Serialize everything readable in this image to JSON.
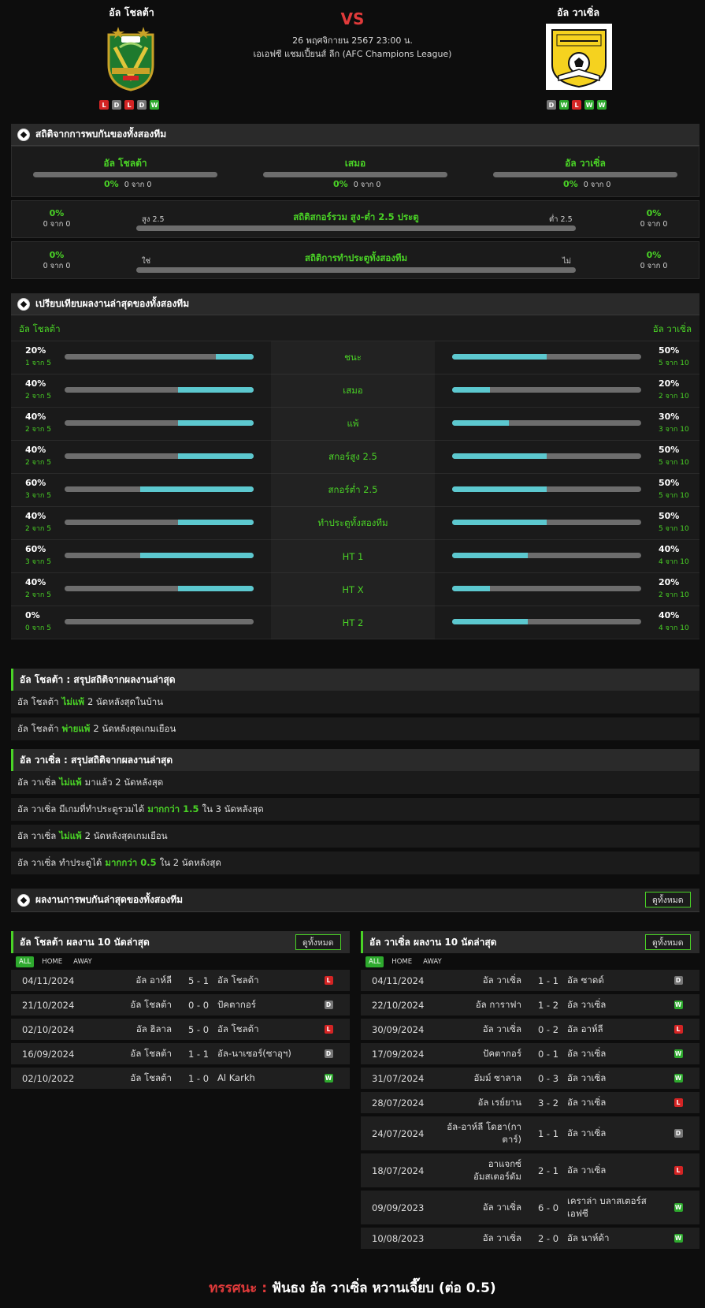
{
  "header": {
    "home_team": "อัล โชลต้า",
    "away_team": "อัล วาเซิ่ล",
    "vs": "VS",
    "datetime": "26 พฤศจิกายน 2567 23:00 น.",
    "league": "เอเอฟซี แชมเปี้ยนส์ ลีก (AFC Champions League)",
    "home_form": [
      "L",
      "D",
      "L",
      "D",
      "W"
    ],
    "away_form": [
      "D",
      "W",
      "L",
      "W",
      "W"
    ]
  },
  "h2h": {
    "title": "สถิติจากการพบกันของทั้งสองทีม",
    "cols": [
      {
        "name": "อัล โชลต้า",
        "pct": "0%",
        "count": "0 จาก 0",
        "frac": 0
      },
      {
        "name": "เสมอ",
        "pct": "0%",
        "count": "0 จาก 0",
        "frac": 0
      },
      {
        "name": "อัล วาเซิ่ล",
        "pct": "0%",
        "count": "0 จาก 0",
        "frac": 0
      }
    ],
    "ou": {
      "title": "สถิติสกอร์รวม สูง-ต่ำ 2.5 ประตู",
      "left_label": "สูง 2.5",
      "right_label": "ต่ำ 2.5",
      "left_pct": "0%",
      "left_count": "0 จาก 0",
      "right_pct": "0%",
      "right_count": "0 จาก 0"
    },
    "btts": {
      "title": "สถิติการทำประตูทั้งสองทีม",
      "left_label": "ใช่",
      "right_label": "ไม่",
      "left_pct": "0%",
      "left_count": "0 จาก 0",
      "right_pct": "0%",
      "right_count": "0 จาก 0"
    }
  },
  "compare": {
    "title": "เปรียบเทียบผลงานล่าสุดของทั้งสองทีม",
    "left_team": "อัล โชลต้า",
    "right_team": "อัล วาเซิ่ล",
    "rows": [
      {
        "label": "ชนะ",
        "l_pct": "20%",
        "l_sub": "1 จาก 5",
        "l_frac": 0.2,
        "r_pct": "50%",
        "r_sub": "5 จาก 10",
        "r_frac": 0.5
      },
      {
        "label": "เสมอ",
        "l_pct": "40%",
        "l_sub": "2 จาก 5",
        "l_frac": 0.4,
        "r_pct": "20%",
        "r_sub": "2 จาก 10",
        "r_frac": 0.2
      },
      {
        "label": "แพ้",
        "l_pct": "40%",
        "l_sub": "2 จาก 5",
        "l_frac": 0.4,
        "r_pct": "30%",
        "r_sub": "3 จาก 10",
        "r_frac": 0.3
      },
      {
        "label": "สกอร์สูง 2.5",
        "l_pct": "40%",
        "l_sub": "2 จาก 5",
        "l_frac": 0.4,
        "r_pct": "50%",
        "r_sub": "5 จาก 10",
        "r_frac": 0.5
      },
      {
        "label": "สกอร์ต่ำ 2.5",
        "l_pct": "60%",
        "l_sub": "3 จาก 5",
        "l_frac": 0.6,
        "r_pct": "50%",
        "r_sub": "5 จาก 10",
        "r_frac": 0.5
      },
      {
        "label": "ทำประตูทั้งสองทีม",
        "l_pct": "40%",
        "l_sub": "2 จาก 5",
        "l_frac": 0.4,
        "r_pct": "50%",
        "r_sub": "5 จาก 10",
        "r_frac": 0.5
      },
      {
        "label": "HT 1",
        "l_pct": "60%",
        "l_sub": "3 จาก 5",
        "l_frac": 0.6,
        "r_pct": "40%",
        "r_sub": "4 จาก 10",
        "r_frac": 0.4
      },
      {
        "label": "HT X",
        "l_pct": "40%",
        "l_sub": "2 จาก 5",
        "l_frac": 0.4,
        "r_pct": "20%",
        "r_sub": "2 จาก 10",
        "r_frac": 0.2
      },
      {
        "label": "HT 2",
        "l_pct": "0%",
        "l_sub": "0 จาก 5",
        "l_frac": 0.0,
        "r_pct": "40%",
        "r_sub": "4 จาก 10",
        "r_frac": 0.4
      }
    ]
  },
  "summary_home": {
    "title": "อัล โชลต้า : สรุปสถิติจากผลงานล่าสุด",
    "rows": [
      {
        "pre": "อัล โชลต้า",
        "hl": "ไม่แพ้",
        "post": "2  นัดหลังสุดในบ้าน"
      },
      {
        "pre": "อัล โชลต้า",
        "hl": "พ่ายแพ้",
        "post": "2  นัดหลังสุดเกมเยือน"
      }
    ]
  },
  "summary_away": {
    "title": "อัล วาเซิ่ล : สรุปสถิติจากผลงานล่าสุด",
    "rows": [
      {
        "pre": "อัล วาเซิ่ล",
        "hl": "ไม่แพ้",
        "post": "มาแล้ว 2 นัดหลังสุด",
        "hl2": "",
        "post2": ""
      },
      {
        "pre": "อัล วาเซิ่ล  มีเกมที่ทำประตูรวมได้",
        "hl": "มากกว่า  1.5",
        "post": "ใน 3 นัดหลังสุด",
        "hl2": "",
        "post2": ""
      },
      {
        "pre": "อัล วาเซิ่ล",
        "hl": "ไม่แพ้",
        "post": "2  นัดหลังสุดเกมเยือน",
        "hl2": "",
        "post2": ""
      },
      {
        "pre": "อัล วาเซิ่ล  ทำประตูได้",
        "hl": "มากกว่า  0.5",
        "post": "ใน 2 นัดหลังสุด",
        "hl2": "",
        "post2": ""
      }
    ]
  },
  "h2h_recent": {
    "title": "ผลงานการพบกันล่าสุดของทั้งสองทีม",
    "view_all": "ดูทั้งหมด"
  },
  "recent_home": {
    "title": "อัล โชลต้า ผลงาน 10 นัดล่าสุด",
    "view_all": "ดูทั้งหมด",
    "tabs": [
      "ALL",
      "HOME",
      "AWAY"
    ],
    "matches": [
      {
        "date": "04/11/2024",
        "home": "อัล อาห์ลี",
        "score": "5 - 1",
        "away": "อัล โชลต้า",
        "res": "L"
      },
      {
        "date": "21/10/2024",
        "home": "อัล โชลต้า",
        "score": "0 - 0",
        "away": "ปัคตากอร์",
        "res": "D"
      },
      {
        "date": "02/10/2024",
        "home": "อัล ฮิลาล",
        "score": "5 - 0",
        "away": "อัล โชลต้า",
        "res": "L"
      },
      {
        "date": "16/09/2024",
        "home": "อัล โชลต้า",
        "score": "1 - 1",
        "away": "อัล-นาเซอร์(ซาอุฯ)",
        "res": "D"
      },
      {
        "date": "02/10/2022",
        "home": "อัล โชลต้า",
        "score": "1 - 0",
        "away": "Al Karkh",
        "res": "W"
      }
    ]
  },
  "recent_away": {
    "title": "อัล วาเซิ่ล ผลงาน 10 นัดล่าสุด",
    "view_all": "ดูทั้งหมด",
    "tabs": [
      "ALL",
      "HOME",
      "AWAY"
    ],
    "matches": [
      {
        "date": "04/11/2024",
        "home": "อัล วาเซิ่ล",
        "score": "1 - 1",
        "away": "อัล ซาดด์",
        "res": "D"
      },
      {
        "date": "22/10/2024",
        "home": "อัล การาฟา",
        "score": "1 - 2",
        "away": "อัล วาเซิ่ล",
        "res": "W"
      },
      {
        "date": "30/09/2024",
        "home": "อัล วาเซิ่ล",
        "score": "0 - 2",
        "away": "อัล อาห์ลี",
        "res": "L"
      },
      {
        "date": "17/09/2024",
        "home": "ปัคตากอร์",
        "score": "0 - 1",
        "away": "อัล วาเซิ่ล",
        "res": "W"
      },
      {
        "date": "31/07/2024",
        "home": "อัมม์ ซาลาล",
        "score": "0 - 3",
        "away": "อัล วาเซิ่ล",
        "res": "W"
      },
      {
        "date": "28/07/2024",
        "home": "อัล เรย์ยาน",
        "score": "3 - 2",
        "away": "อัล วาเซิ่ล",
        "res": "L"
      },
      {
        "date": "24/07/2024",
        "home": "อัล-อาห์ลี โดฮา(กาตาร์)",
        "score": "1 - 1",
        "away": "อัล วาเซิ่ล",
        "res": "D"
      },
      {
        "date": "18/07/2024",
        "home": "อาแจกซ์ อัมสเตอร์ดัม",
        "score": "2 - 1",
        "away": "อัล วาเซิ่ล",
        "res": "L"
      },
      {
        "date": "09/09/2023",
        "home": "อัล วาเซิ่ล",
        "score": "6 - 0",
        "away": "เคราล่า บลาสเตอร์ส เอฟซี",
        "res": "W"
      },
      {
        "date": "10/08/2023",
        "home": "อัล วาเซิ่ล",
        "score": "2 - 0",
        "away": "อัล นาห์ด้า",
        "res": "W"
      }
    ]
  },
  "footer": {
    "label": "ทรรศนะ :",
    "text": "ฟันธง อัล วาเซิ่ล หวานเจี๊ยบ (ต่อ 0.5)"
  },
  "colors": {
    "accent": "#4ad326",
    "bar_fill": "#5cc8cf",
    "red": "#e03a3a"
  }
}
